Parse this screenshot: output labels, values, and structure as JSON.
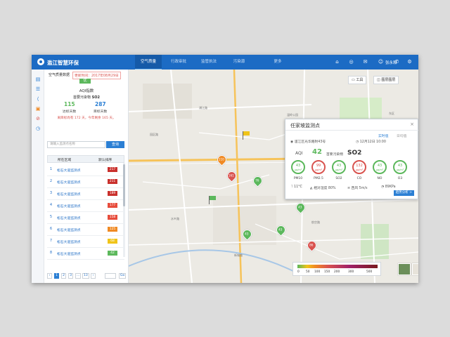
{
  "app": {
    "title": "滥江智慧环保"
  },
  "nav": {
    "tabs": [
      "空气质量",
      "行政审批",
      "监管执法",
      "污染源",
      "·",
      "更多"
    ],
    "user": "张永和"
  },
  "panel": {
    "title": "空气质量数据",
    "update_time": "更新时间：2017年08月29日",
    "aqi_level": "优",
    "aqi_label": "AQI指数",
    "primary_label": "首要污染物",
    "primary_value": "SO2",
    "reach_days": "115",
    "target_days": "287",
    "reach_days_label": "达标天数",
    "target_days_label": "目标天数",
    "summary": "离目标尚有 172 天，今年剩余 165 天。",
    "search_placeholder": "请输入监测点名称",
    "search_btn": "查询",
    "col_area": "所在区域",
    "col_sort": "默认排序",
    "rows": [
      {
        "no": "1",
        "name": "松石大道监测点",
        "value": "217",
        "color": "#c9302c"
      },
      {
        "no": "2",
        "name": "松石大道监测点",
        "value": "211",
        "color": "#c9302c"
      },
      {
        "no": "3",
        "name": "松石大道监测点",
        "value": "189",
        "color": "#c9302c"
      },
      {
        "no": "4",
        "name": "松石大道监测点",
        "value": "177",
        "color": "#e74c3c"
      },
      {
        "no": "5",
        "name": "松石大道监测点",
        "value": "158",
        "color": "#e74c3c"
      },
      {
        "no": "6",
        "name": "松石大道监测点",
        "value": "125",
        "color": "#f08a24"
      },
      {
        "no": "7",
        "name": "松石大道监测点",
        "value": "68",
        "color": "#f0c419"
      },
      {
        "no": "8",
        "name": "松石大道监测点",
        "value": "42",
        "color": "#5cb85c"
      }
    ],
    "pager": [
      "‹",
      "1",
      "2",
      "3",
      "...",
      "13",
      "›",
      "",
      "Go"
    ]
  },
  "map": {
    "tool_btn": "工具",
    "layer_btn": "图层图层",
    "labels": [
      "温岭公园",
      "园区路",
      "浦江路",
      "东区",
      "水乡路",
      "航空路",
      "新城路"
    ],
    "markers": [
      {
        "value": "110",
        "color": "#f08a24"
      },
      {
        "value": "161",
        "color": "#d9534f"
      },
      {
        "value": "76",
        "color": "#5cb85c"
      },
      {
        "value": "43",
        "color": "#5cb85c"
      },
      {
        "value": "43",
        "color": "#5cb85c"
      },
      {
        "value": "86",
        "color": "#d9534f"
      },
      {
        "value": "43",
        "color": "#5cb85c"
      }
    ],
    "legend_ticks": [
      "0",
      "50",
      "100",
      "150",
      "200",
      "300",
      "500"
    ]
  },
  "popup": {
    "title": "任家坡监测点",
    "tab_realtime": "实时值",
    "tab_daily": "日均值",
    "address": "滥江区光华路附43号",
    "time": "12月12日 10:00",
    "aqi_label": "AQI",
    "aqi_value": "42",
    "primary_label": "首要污染物",
    "primary_value": "SO2",
    "pollutants": [
      {
        "value": "43",
        "unit": "μg/m³",
        "label": "PM10",
        "color": "#5cb85c"
      },
      {
        "value": "99",
        "unit": "μg/m³",
        "label": "PM2.5",
        "color": "#d9534f"
      },
      {
        "value": "43",
        "unit": "μg/m³",
        "label": "SO2",
        "color": "#5cb85c"
      },
      {
        "value": "132",
        "unit": "μg/m³",
        "label": "CO",
        "color": "#d9534f"
      },
      {
        "value": "43",
        "unit": "μg/m³",
        "label": "NO",
        "color": "#5cb85c"
      },
      {
        "value": "43",
        "unit": "μg/m³",
        "label": "O3",
        "color": "#5cb85c"
      }
    ],
    "temp": "11°C",
    "humidity": "相对湿度 80%",
    "wind": "西风 5m/s",
    "pressure": "89KPa",
    "analysis_btn": "趋势分析 >"
  }
}
